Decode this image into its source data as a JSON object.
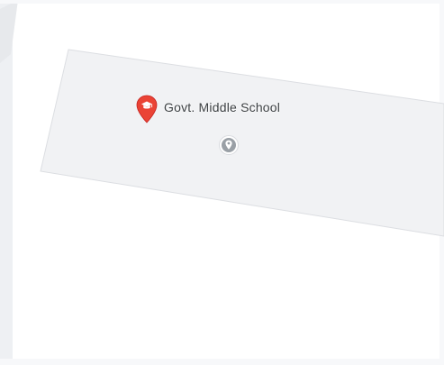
{
  "map": {
    "place": {
      "name": "Govt. Middle School",
      "icon": "school-pin-icon",
      "pin_color": "#ea4335"
    },
    "marker": {
      "icon": "location-pin-icon"
    },
    "colors": {
      "background": "#ffffff",
      "area_fill": "#f1f2f4",
      "area_stroke": "#dcdee2",
      "road": "#f7f8fa",
      "edge_block": "#eef0f3"
    }
  }
}
